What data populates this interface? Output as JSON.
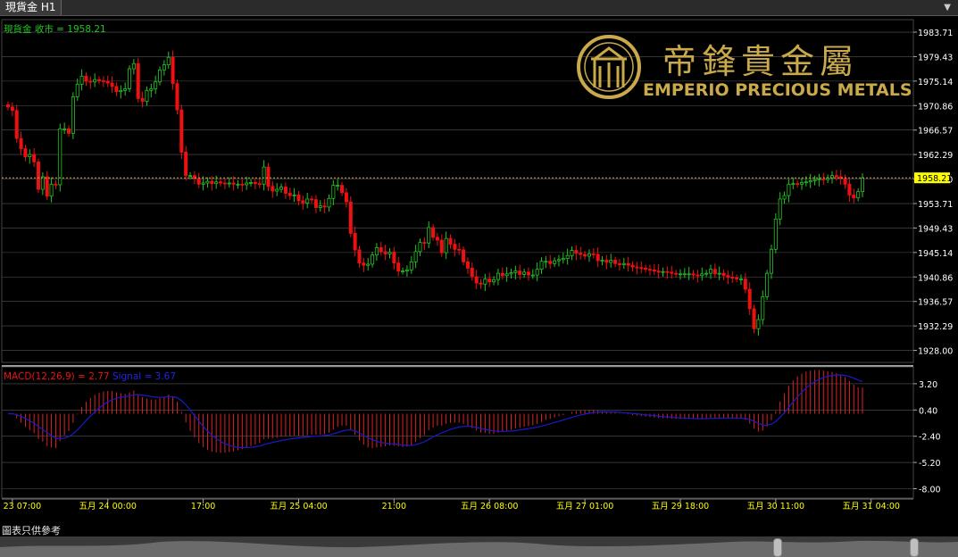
{
  "window": {
    "tab_title": "現貨金 H1",
    "footer_note": "圖表只供參考"
  },
  "brand": {
    "logo_chinese": "帝鋒貴金屬",
    "logo_english": "EMPERIO PRECIOUS METALS",
    "logo_color": "#c9a94a"
  },
  "colors": {
    "up": "#22c522",
    "down": "#ee1111",
    "signal": "#1a1acc",
    "macd_bar": "#dd2222",
    "grid": "#555555",
    "axis_text": "#ffffff",
    "time_text": "#ffff00",
    "price_line": "#d8a850"
  },
  "chart_data": [
    {
      "type": "candlestick",
      "legend": "現貨金 收市 = 1958.21",
      "legend_color": "#22c522",
      "ylim": [
        1925.9,
        1985.9
      ],
      "y_ticks": [
        1983.71,
        1979.43,
        1975.14,
        1970.86,
        1966.57,
        1962.29,
        1958.0,
        1953.71,
        1949.43,
        1945.14,
        1940.86,
        1936.57,
        1932.29,
        1928.0
      ],
      "y_tick_labels": [
        "1983.71",
        "1979.43",
        "1975.14",
        "1970.86",
        "1966.57",
        "1962.29",
        "1958.00",
        "1953.71",
        "1949.43",
        "1945.14",
        "1940.86",
        "1936.57",
        "1932.29",
        "1928.00"
      ],
      "last_price": 1958.21,
      "last_price_label": "1958.21",
      "x_labels": [
        "五月 23 07:00",
        "五月 24 00:00",
        "17:00",
        "五月 25 04:00",
        "21:00",
        "五月 26 08:00",
        "五月 27 01:00",
        "五月 29 18:00",
        "五月 30 11:00",
        "五月 31 04:00"
      ],
      "x_label_index": [
        1,
        23,
        45,
        67,
        89,
        111,
        133,
        155,
        177,
        199
      ],
      "close": [
        1970.6,
        1970.0,
        1965.1,
        1963.3,
        1961.9,
        1962.3,
        1961.0,
        1956.2,
        1958.4,
        1955.0,
        1957.1,
        1957.0,
        1966.8,
        1966.8,
        1966.0,
        1972.4,
        1974.6,
        1976.0,
        1975.1,
        1975.0,
        1975.4,
        1975.2,
        1975.1,
        1974.8,
        1974.2,
        1973.3,
        1973.5,
        1973.8,
        1977.3,
        1978.2,
        1972.1,
        1971.6,
        1973.5,
        1973.8,
        1975.0,
        1977.1,
        1978.0,
        1979.3,
        1974.7,
        1970.1,
        1962.7,
        1958.6,
        1958.6,
        1958.1,
        1957.1,
        1957.3,
        1957.6,
        1957.2,
        1957.5,
        1957.3,
        1957.2,
        1957.3,
        1957.1,
        1957.1,
        1957.0,
        1957.3,
        1957.4,
        1957.2,
        1957.1,
        1960.1,
        1956.7,
        1955.9,
        1956.2,
        1956.6,
        1955.5,
        1955.1,
        1955.2,
        1954.2,
        1953.8,
        1954.5,
        1954.4,
        1953.0,
        1953.3,
        1953.1,
        1954.6,
        1956.9,
        1956.9,
        1955.6,
        1954.0,
        1948.5,
        1945.6,
        1943.3,
        1942.9,
        1943.1,
        1944.7,
        1946.0,
        1945.3,
        1944.9,
        1945.2,
        1943.3,
        1941.9,
        1941.9,
        1942.1,
        1943.5,
        1945.3,
        1946.9,
        1946.8,
        1949.5,
        1947.8,
        1947.3,
        1945.1,
        1947.6,
        1946.6,
        1945.7,
        1945.6,
        1943.5,
        1942.4,
        1940.9,
        1939.8,
        1939.6,
        1940.5,
        1940.0,
        1940.4,
        1941.5,
        1941.1,
        1941.4,
        1941.6,
        1941.9,
        1941.3,
        1941.7,
        1941.2,
        1941.2,
        1942.2,
        1943.6,
        1943.6,
        1943.2,
        1943.7,
        1943.9,
        1944.1,
        1944.6,
        1945.5,
        1945.0,
        1944.8,
        1944.5,
        1944.9,
        1944.8,
        1943.7,
        1943.8,
        1943.4,
        1943.8,
        1943.2,
        1943.0,
        1943.2,
        1942.9,
        1942.6,
        1942.5,
        1942.4,
        1942.2,
        1942.1,
        1941.9,
        1941.7,
        1941.8,
        1941.7,
        1941.5,
        1941.4,
        1941.4,
        1941.4,
        1941.4,
        1941.2,
        1941.1,
        1941.4,
        1941.5,
        1942.2,
        1941.4,
        1941.5,
        1941.1,
        1940.8,
        1940.7,
        1940.5,
        1940.5,
        1938.7,
        1935.3,
        1931.8,
        1933.4,
        1937.4,
        1941.5,
        1945.7,
        1951.0,
        1954.5,
        1955.1,
        1957.1,
        1957.2,
        1957.1,
        1957.4,
        1957.5,
        1957.7,
        1957.9,
        1958.0,
        1957.9,
        1958.2,
        1958.6,
        1958.4,
        1958.1,
        1957.1,
        1955.2,
        1954.7,
        1955.8,
        1958.2
      ],
      "highs_lows_note": "",
      "macd": {
        "legend_macd": "MACD(12,26,9) = 2.77",
        "legend_signal": "Signal = 3.67",
        "legend_macd_color": "#ee1111",
        "legend_signal_color": "#2222ee",
        "ylim": [
          -9.0,
          5.0
        ],
        "y_ticks": [
          3.2,
          0.4,
          -2.4,
          -5.2,
          -8.0
        ],
        "y_tick_labels": [
          "3.20",
          "0.40",
          "-2.40",
          "-5.20",
          "-8.00"
        ],
        "macd_last": 2.77,
        "signal_last": 3.67
      }
    }
  ]
}
